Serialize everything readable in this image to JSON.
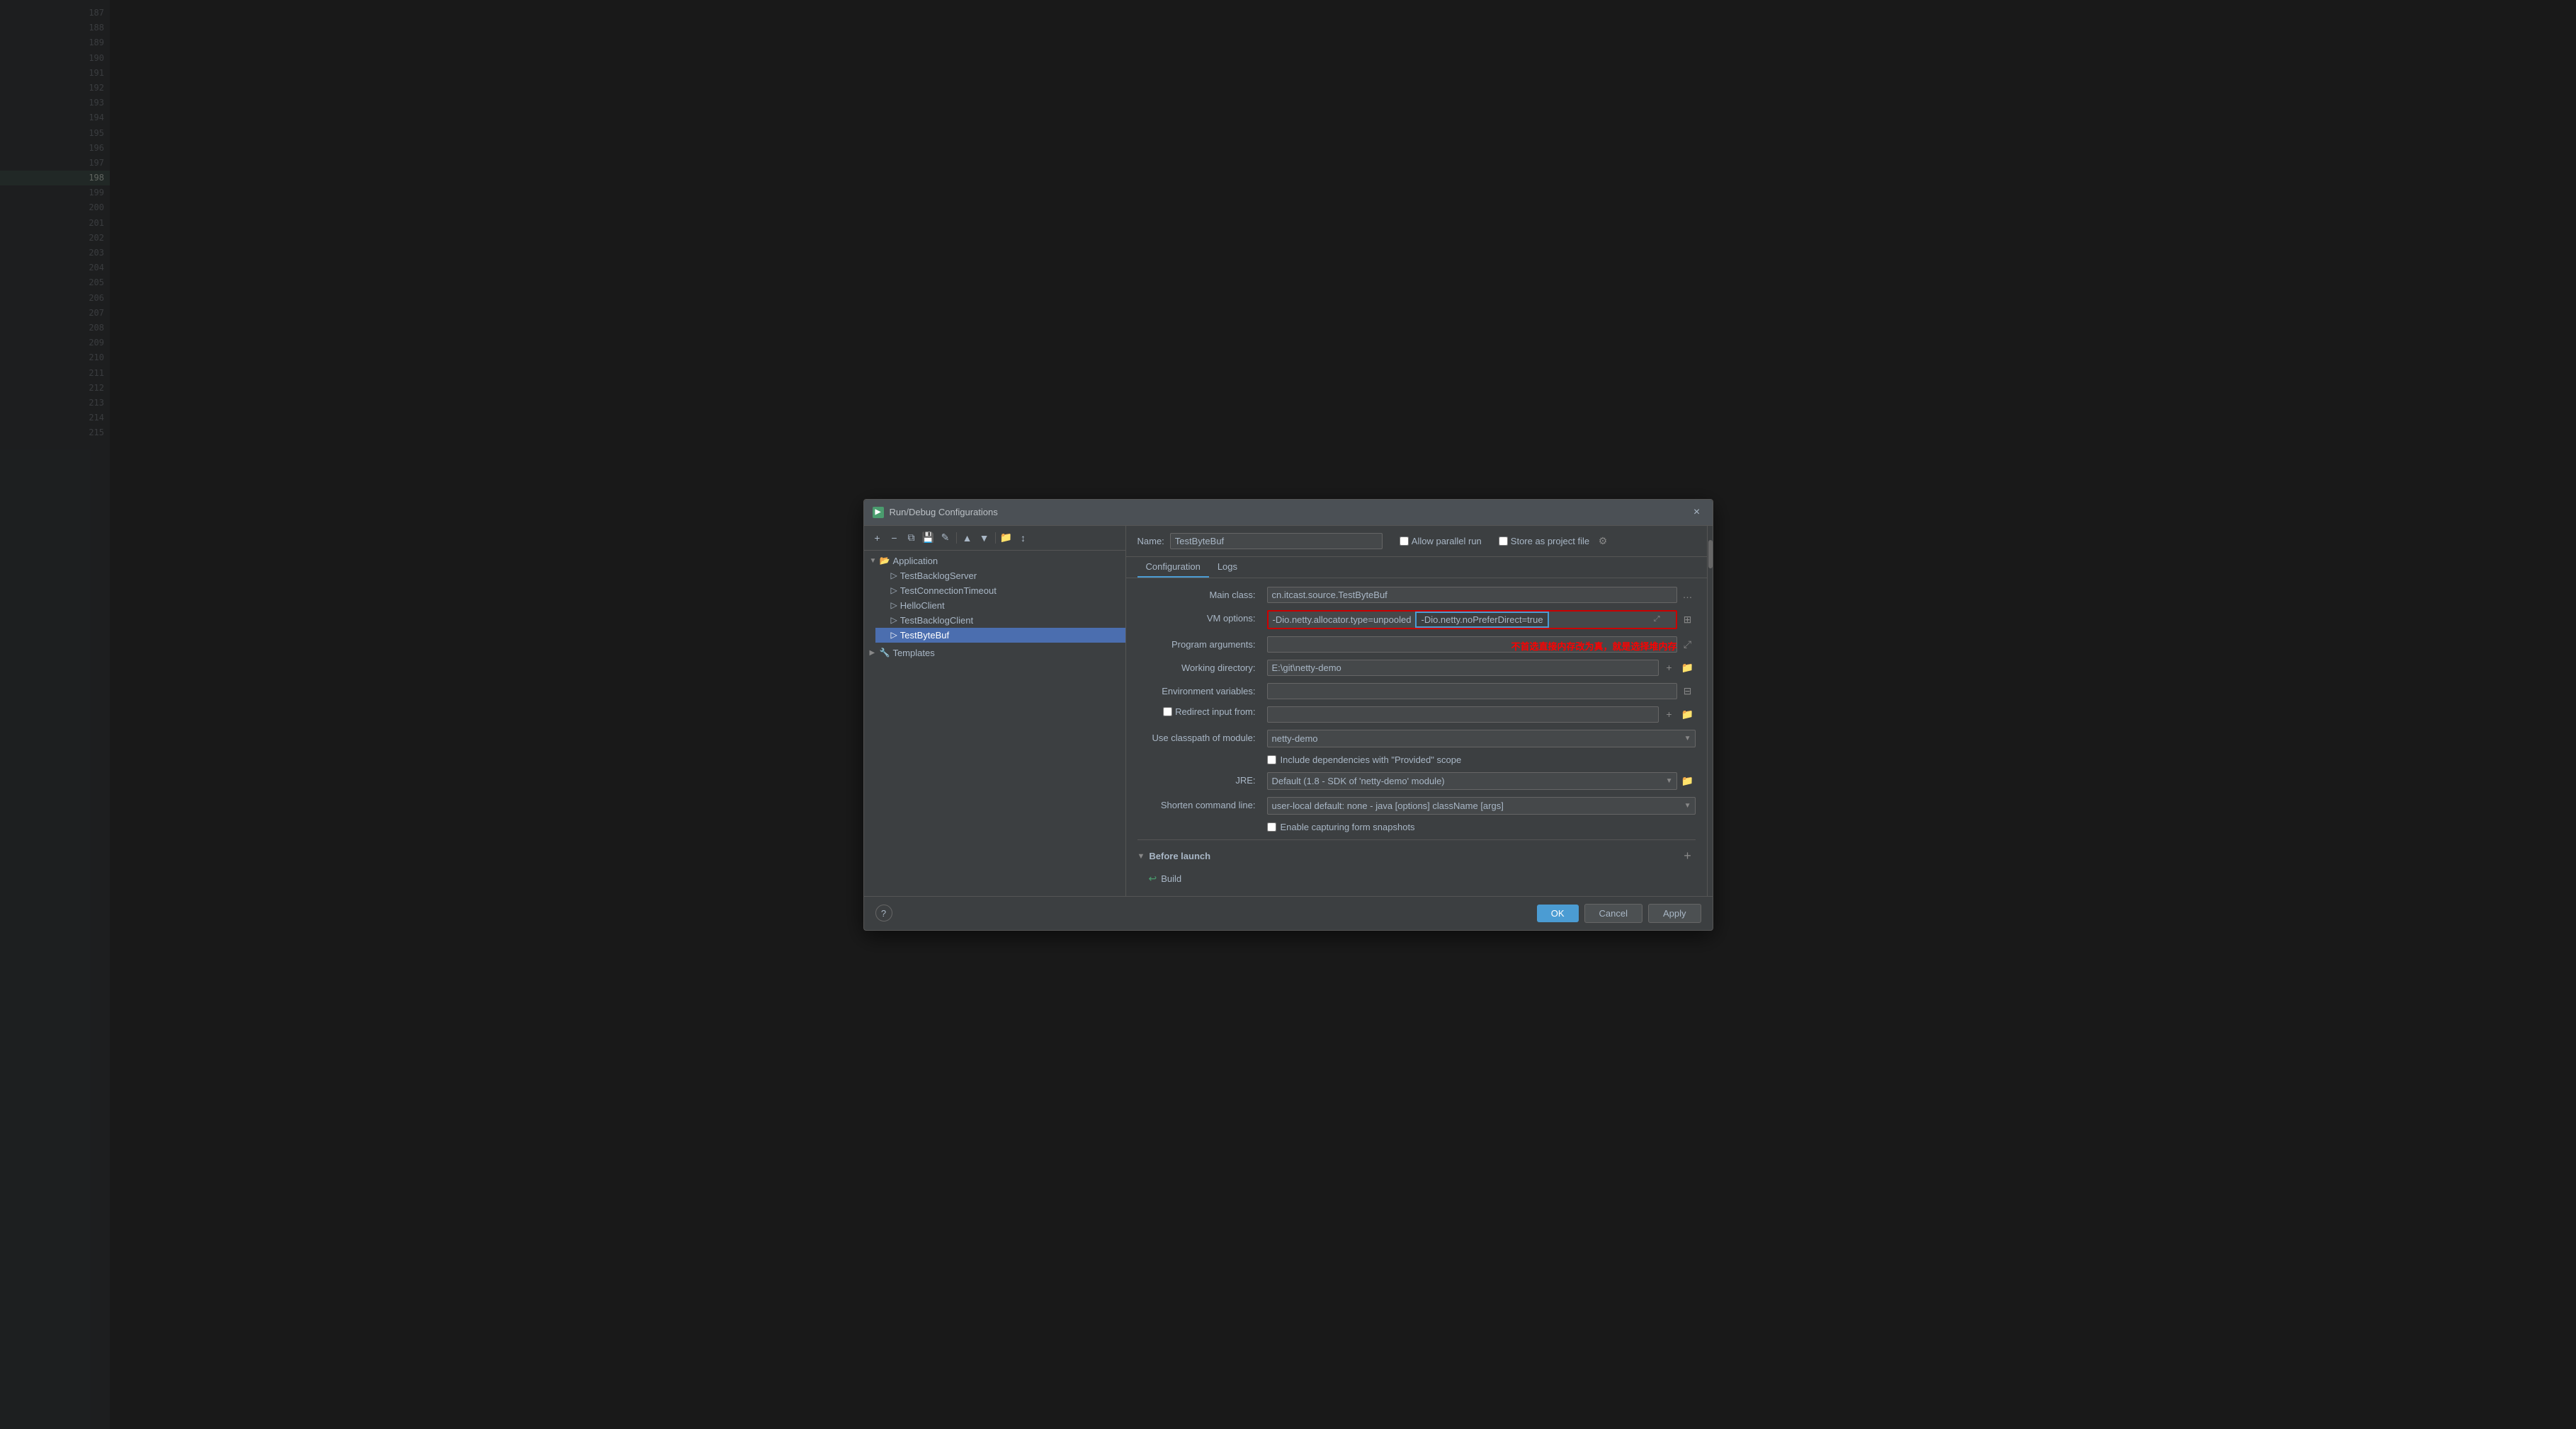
{
  "dialog": {
    "title": "Run/Debug Configurations",
    "close_label": "×"
  },
  "toolbar": {
    "add_btn": "+",
    "remove_btn": "−",
    "copy_btn": "⧉",
    "save_btn": "💾",
    "edit_btn": "✎",
    "up_btn": "▲",
    "down_btn": "▼",
    "folder_btn": "📁",
    "sort_btn": "↕"
  },
  "tree": {
    "application_label": "Application",
    "application_arrow": "▼",
    "items": [
      {
        "label": "TestBacklogServer",
        "selected": false
      },
      {
        "label": "TestConnectionTimeout",
        "selected": false
      },
      {
        "label": "HelloClient",
        "selected": false
      },
      {
        "label": "TestBacklogClient",
        "selected": false
      },
      {
        "label": "TestByteBuf",
        "selected": true
      }
    ],
    "templates_arrow": "▶",
    "templates_label": "Templates"
  },
  "name_row": {
    "label": "Name:",
    "value": "TestByteBuf",
    "allow_parallel_run_label": "Allow parallel run",
    "store_as_project_file_label": "Store as project file"
  },
  "tabs": [
    {
      "label": "Configuration",
      "active": true
    },
    {
      "label": "Logs",
      "active": false
    }
  ],
  "form": {
    "main_class_label": "Main class:",
    "main_class_value": "cn.itcast.source.TestByteBuf",
    "vm_options_label": "VM options:",
    "vm_options_part1": "-Dio.netty.allocator.type=unpooled",
    "vm_options_part2": "-Dio.netty.noPreferDirect=true",
    "program_args_label": "Program arguments:",
    "program_args_value": "",
    "red_annotation": "不首选直接内存改为真，就是选择堆内存",
    "working_dir_label": "Working directory:",
    "working_dir_value": "E:\\git\\netty-demo",
    "env_vars_label": "Environment variables:",
    "env_vars_value": "",
    "redirect_input_label": "Redirect input from:",
    "redirect_input_value": "",
    "redirect_checked": false,
    "use_classpath_label": "Use classpath of module:",
    "use_classpath_value": "netty-demo",
    "include_deps_label": "Include dependencies with \"Provided\" scope",
    "include_deps_checked": false,
    "jre_label": "JRE:",
    "jre_value": "Default (1.8 - SDK of 'netty-demo' module)",
    "shorten_cmd_label": "Shorten command line:",
    "shorten_cmd_value": "user-local default: none - java [options] className [args]",
    "enable_snapshots_label": "Enable capturing form snapshots",
    "enable_snapshots_checked": false
  },
  "before_launch": {
    "section_label": "Before launch",
    "arrow": "▼",
    "build_label": "Build",
    "plus_btn": "+"
  },
  "footer": {
    "help_label": "?",
    "ok_label": "OK",
    "cancel_label": "Cancel",
    "apply_label": "Apply"
  },
  "line_numbers": [
    "187",
    "188",
    "189",
    "190",
    "191",
    "192",
    "193",
    "194",
    "195",
    "196",
    "197",
    "198",
    "199",
    "200",
    "201",
    "202",
    "203",
    "204",
    "205",
    "206",
    "207",
    "208",
    "209",
    "210",
    "211",
    "212",
    "213",
    "214",
    "215"
  ]
}
